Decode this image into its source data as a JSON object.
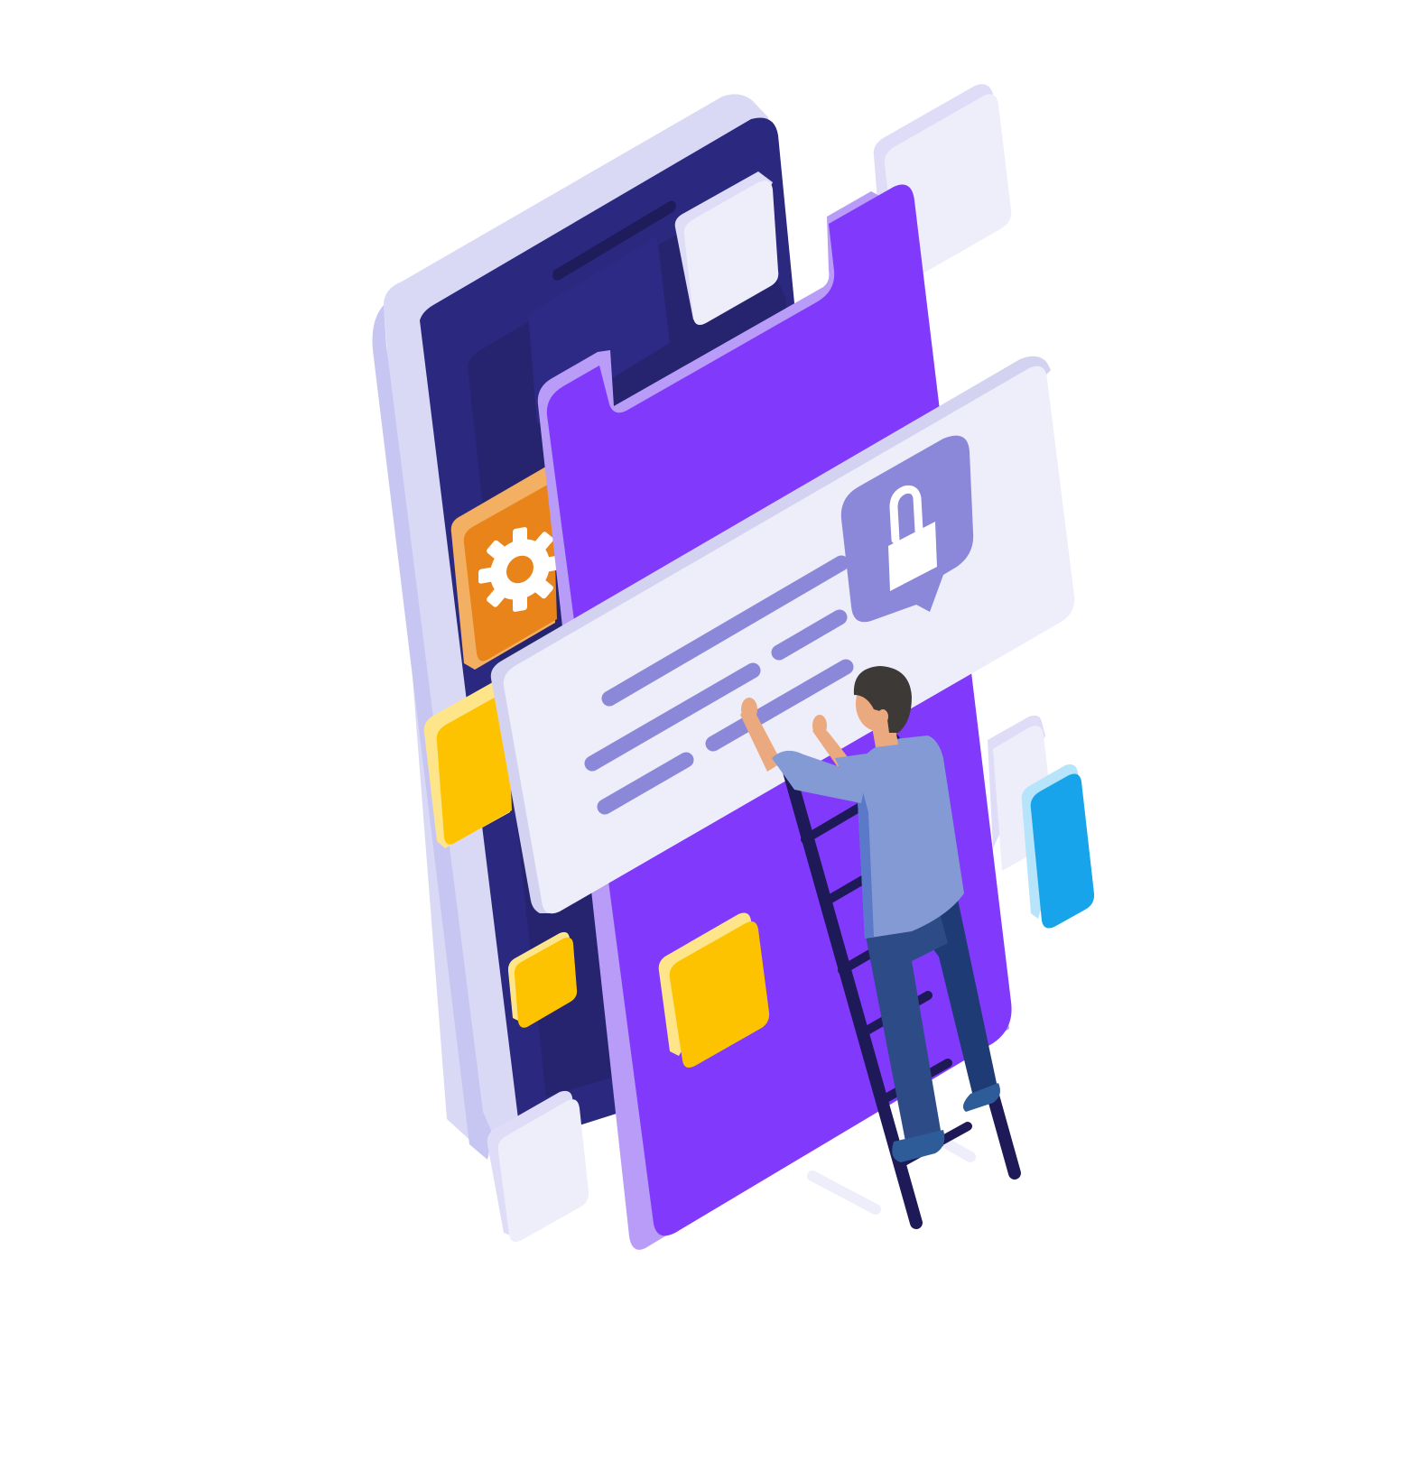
{
  "illustration": {
    "subject": "isometric-app-development",
    "palette": {
      "background": "#ffffff",
      "phone_back_frame": "#d9d9f6",
      "phone_back_screen": "#2b2880",
      "phone_back_inner": "#26236f",
      "phone_front_edge": "#b99cf7",
      "phone_front_screen": "#8139fb",
      "card_face": "#eeeefa",
      "card_edge": "#d3d3f1",
      "text_line": "#8b87d9",
      "lock_bubble": "#8b87d9",
      "gear_tile": "#e8841a",
      "gear_tile_edge": "#f4b062",
      "yellow_tile": "#fec300",
      "yellow_tile_edge": "#ffe58a",
      "blue_tile": "#17a4ea",
      "blue_tile_edge": "#b5e4fb",
      "ladder": "#1e1a57",
      "shirt": "#839ad5",
      "shirt_shade": "#5b79c9",
      "pants": "#2d4b87",
      "pants_shade": "#1f3b75",
      "skin": "#eaa97e",
      "hair": "#3d3936",
      "shoe": "#2e5c99"
    },
    "icons": [
      "gear-icon",
      "lock-icon"
    ]
  }
}
